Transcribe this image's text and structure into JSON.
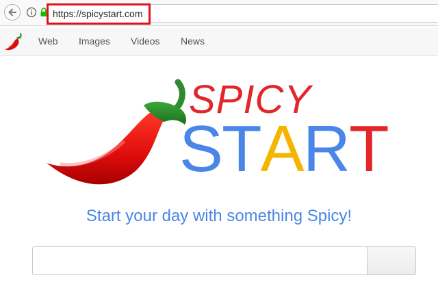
{
  "browser": {
    "url": "https://spicystart.com"
  },
  "nav": {
    "items": [
      {
        "label": "Web"
      },
      {
        "label": "Images"
      },
      {
        "label": "Videos"
      },
      {
        "label": "News"
      }
    ]
  },
  "logo": {
    "top_word": "SPICY",
    "bottom_letters": [
      {
        "char": "S",
        "color": "#4a86e8"
      },
      {
        "char": "T",
        "color": "#4a86e8"
      },
      {
        "char": "A",
        "color": "#f4b400"
      },
      {
        "char": "R",
        "color": "#4a86e8"
      },
      {
        "char": "T",
        "color": "#e3262a"
      }
    ],
    "top_color": "#e3262a"
  },
  "tagline": "Start your day with something Spicy!",
  "search": {
    "value": "",
    "button_label": ""
  },
  "icons": {
    "back": "back-arrow-icon",
    "info": "info-icon",
    "lock": "lock-icon",
    "pepper": "chili-pepper-icon"
  }
}
